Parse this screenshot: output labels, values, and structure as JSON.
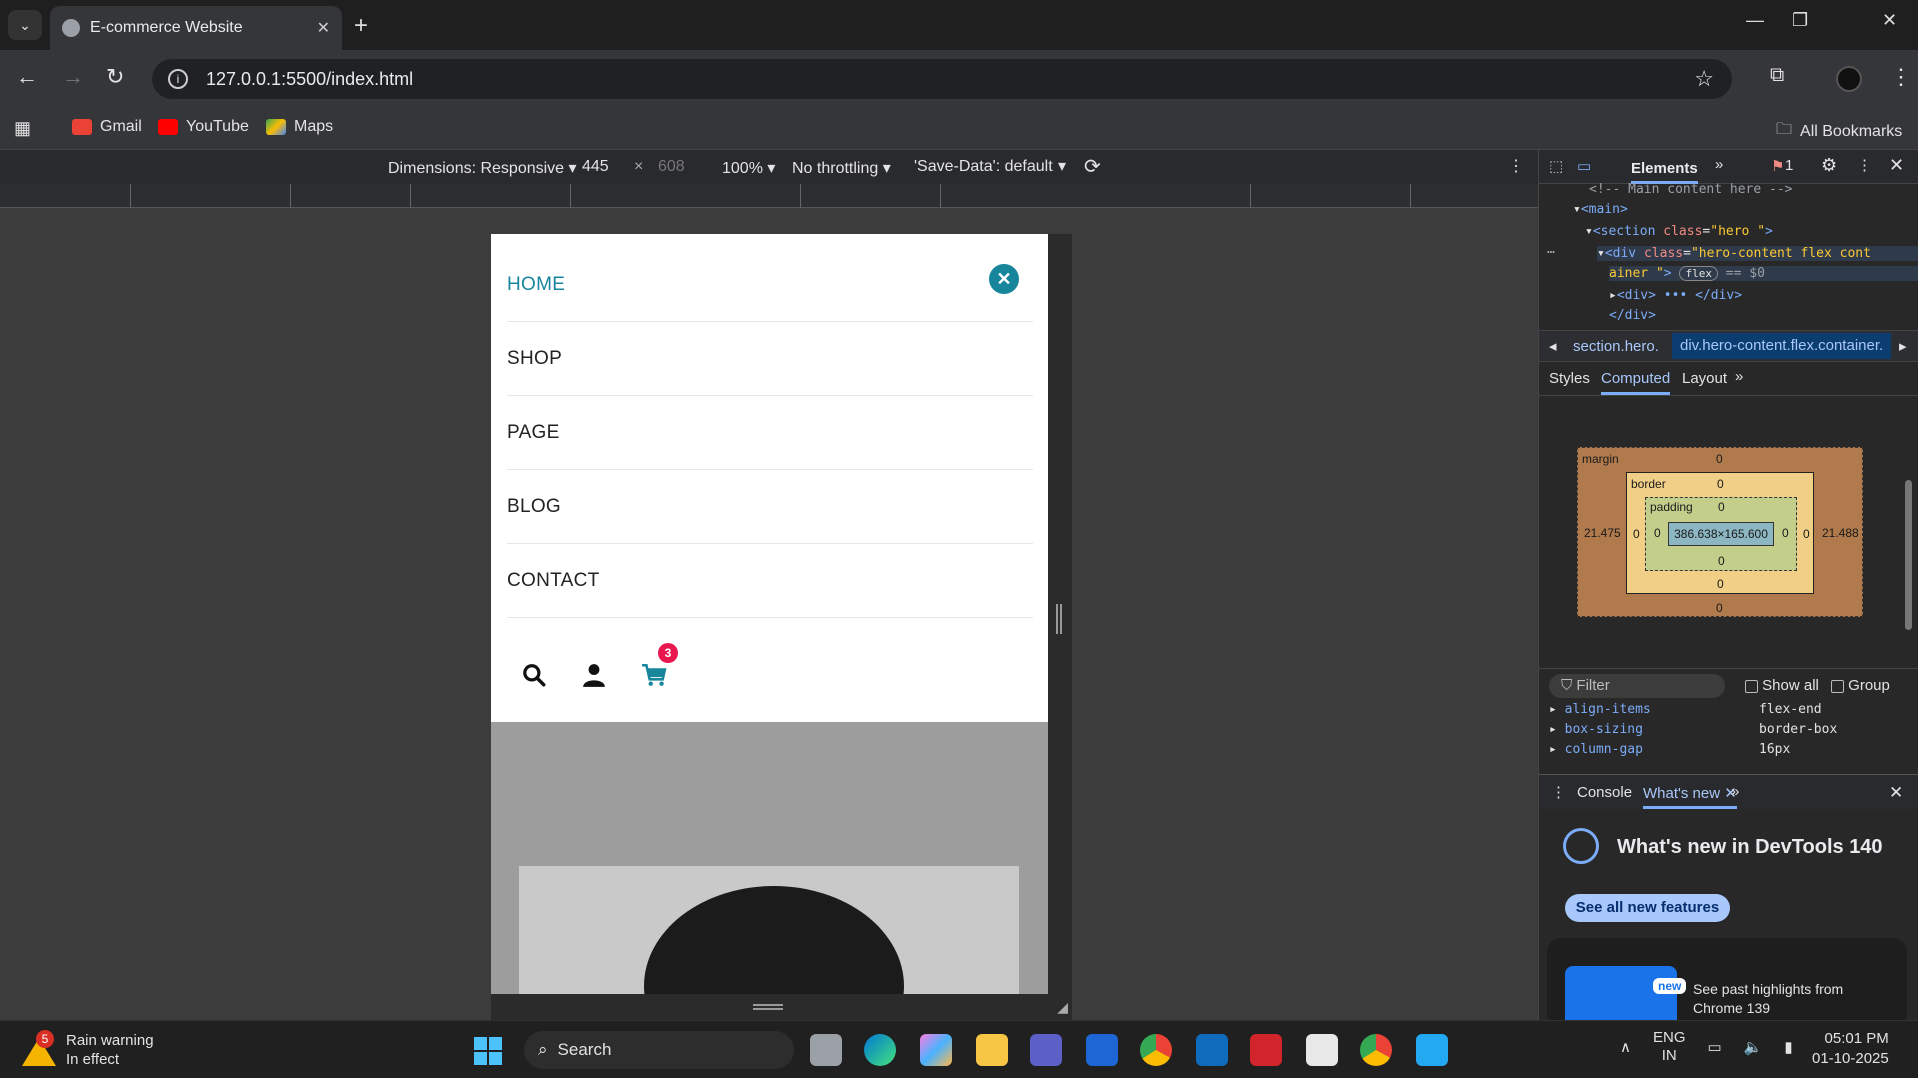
{
  "browser": {
    "tab_title": "E-commerce Website",
    "url": "127.0.0.1:5500/index.html",
    "bookmarks": [
      "Gmail",
      "YouTube",
      "Maps"
    ],
    "all_bookmarks": "All Bookmarks"
  },
  "device_toolbar": {
    "dimensions": "Dimensions: Responsive ▾",
    "width": "445",
    "times": "×",
    "height": "608",
    "zoom": "100% ▾",
    "throttling": "No throttling ▾",
    "save_data": "'Save-Data': default"
  },
  "page": {
    "menu_items": [
      "HOME",
      "SHOP",
      "PAGE",
      "BLOG",
      "CONTACT"
    ],
    "close_symbol": "✕",
    "cart_count": "3"
  },
  "devtools": {
    "elements_tab": "Elements",
    "issue_count": "1",
    "dom": {
      "comment": "<!-- Main content here -->",
      "main": "main",
      "section_tag": "section",
      "section_class": "hero ",
      "div_class": "hero-content flex cont",
      "div_class_cont": "ainer ",
      "flex_badge": "flex",
      "eq": "== $0",
      "div_child": "<div> ••• </div>",
      "div_close": "</div>"
    },
    "breadcrumbs": [
      "section.hero.",
      "div.hero-content.flex.container."
    ],
    "subtabs": [
      "Styles",
      "Computed",
      "Layout"
    ],
    "box_model": {
      "margin_label": "margin",
      "border_label": "border",
      "padding_label": "padding",
      "margin_top": "0",
      "margin_bottom": "0",
      "margin_left": "21.475",
      "margin_right": "21.488",
      "border_top": "0",
      "border_bottom": "0",
      "border_left": "0",
      "border_right": "0",
      "padding_top": "0",
      "padding_bottom": "0",
      "padding_left": "0",
      "padding_right": "0",
      "content": "386.638×165.600"
    },
    "filter": {
      "placeholder": "Filter",
      "show_all": "Show all",
      "group": "Group"
    },
    "computed": [
      {
        "name": "align-items",
        "value": "flex-end"
      },
      {
        "name": "box-sizing",
        "value": "border-box"
      },
      {
        "name": "column-gap",
        "value": "16px"
      }
    ],
    "drawer": {
      "console": "Console",
      "whats_new": "What's new"
    },
    "whats_new": {
      "title": "What's new in DevTools 140",
      "button": "See all new features",
      "badge": "new",
      "card_text": "See past highlights from Chrome 139"
    }
  },
  "taskbar": {
    "weather_title": "Rain warning",
    "weather_sub": "In effect",
    "weather_badge": "5",
    "search": "Search",
    "lang": "ENG",
    "region": "IN",
    "time": "05:01 PM",
    "date": "01-10-2025"
  }
}
